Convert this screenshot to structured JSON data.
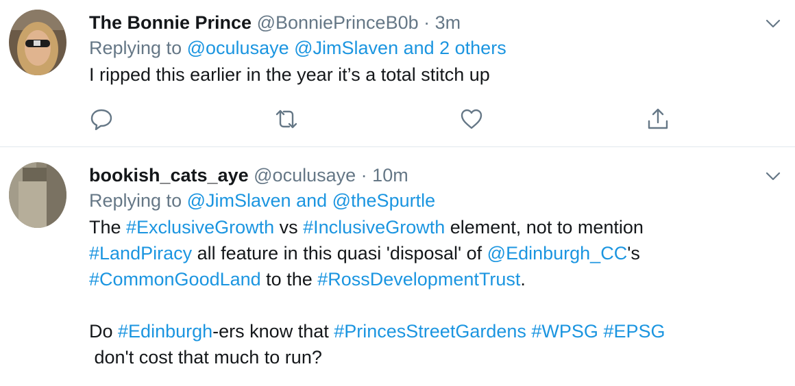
{
  "tweets": [
    {
      "name": "The Bonnie Prince",
      "handle": "@BonniePrinceB0b",
      "sep": "·",
      "time": "3m",
      "replying_label": "Replying to",
      "reply_to_1": "@oculusaye",
      "reply_to_2": "@JimSlaven and 2 others",
      "text": "I ripped this earlier in the year it’s a total stitch up"
    },
    {
      "name": "bookish_cats_aye",
      "handle": "@oculusaye",
      "sep": "·",
      "time": "10m",
      "replying_label": "Replying to",
      "reply_to_1": "@JimSlaven and @theSpurtle",
      "body": {
        "l1_a": "The ",
        "l1_tag1": "#ExclusiveGrowth",
        "l1_b": " vs ",
        "l1_tag2": "#InclusiveGrowth",
        "l1_c": " element, not to mention",
        "l2_tag1": "#LandPiracy",
        "l2_a": " all feature in this quasi 'disposal' of ",
        "l2_mention": "@Edinburgh_CC",
        "l2_b": "'s",
        "l3_tag1": "#CommonGoodLand",
        "l3_a": " to the ",
        "l3_tag2": "#RossDevelopmentTrust",
        "l3_b": ".",
        "l5_a": "Do ",
        "l5_tag1": "#Edinburgh",
        "l5_b": "-ers know that ",
        "l5_tag2": "#PrincesStreetGardens",
        "l5_tag3": "#WPSG",
        "l5_tag4": "#EPSG",
        "l6": " don't cost that much to run?"
      }
    }
  ],
  "colors": {
    "link": "#1b95e0",
    "meta": "#657786",
    "divider": "#e1e8ed"
  },
  "icons": [
    "reply-icon",
    "retweet-icon",
    "like-icon",
    "share-icon",
    "chevron-down-icon"
  ]
}
